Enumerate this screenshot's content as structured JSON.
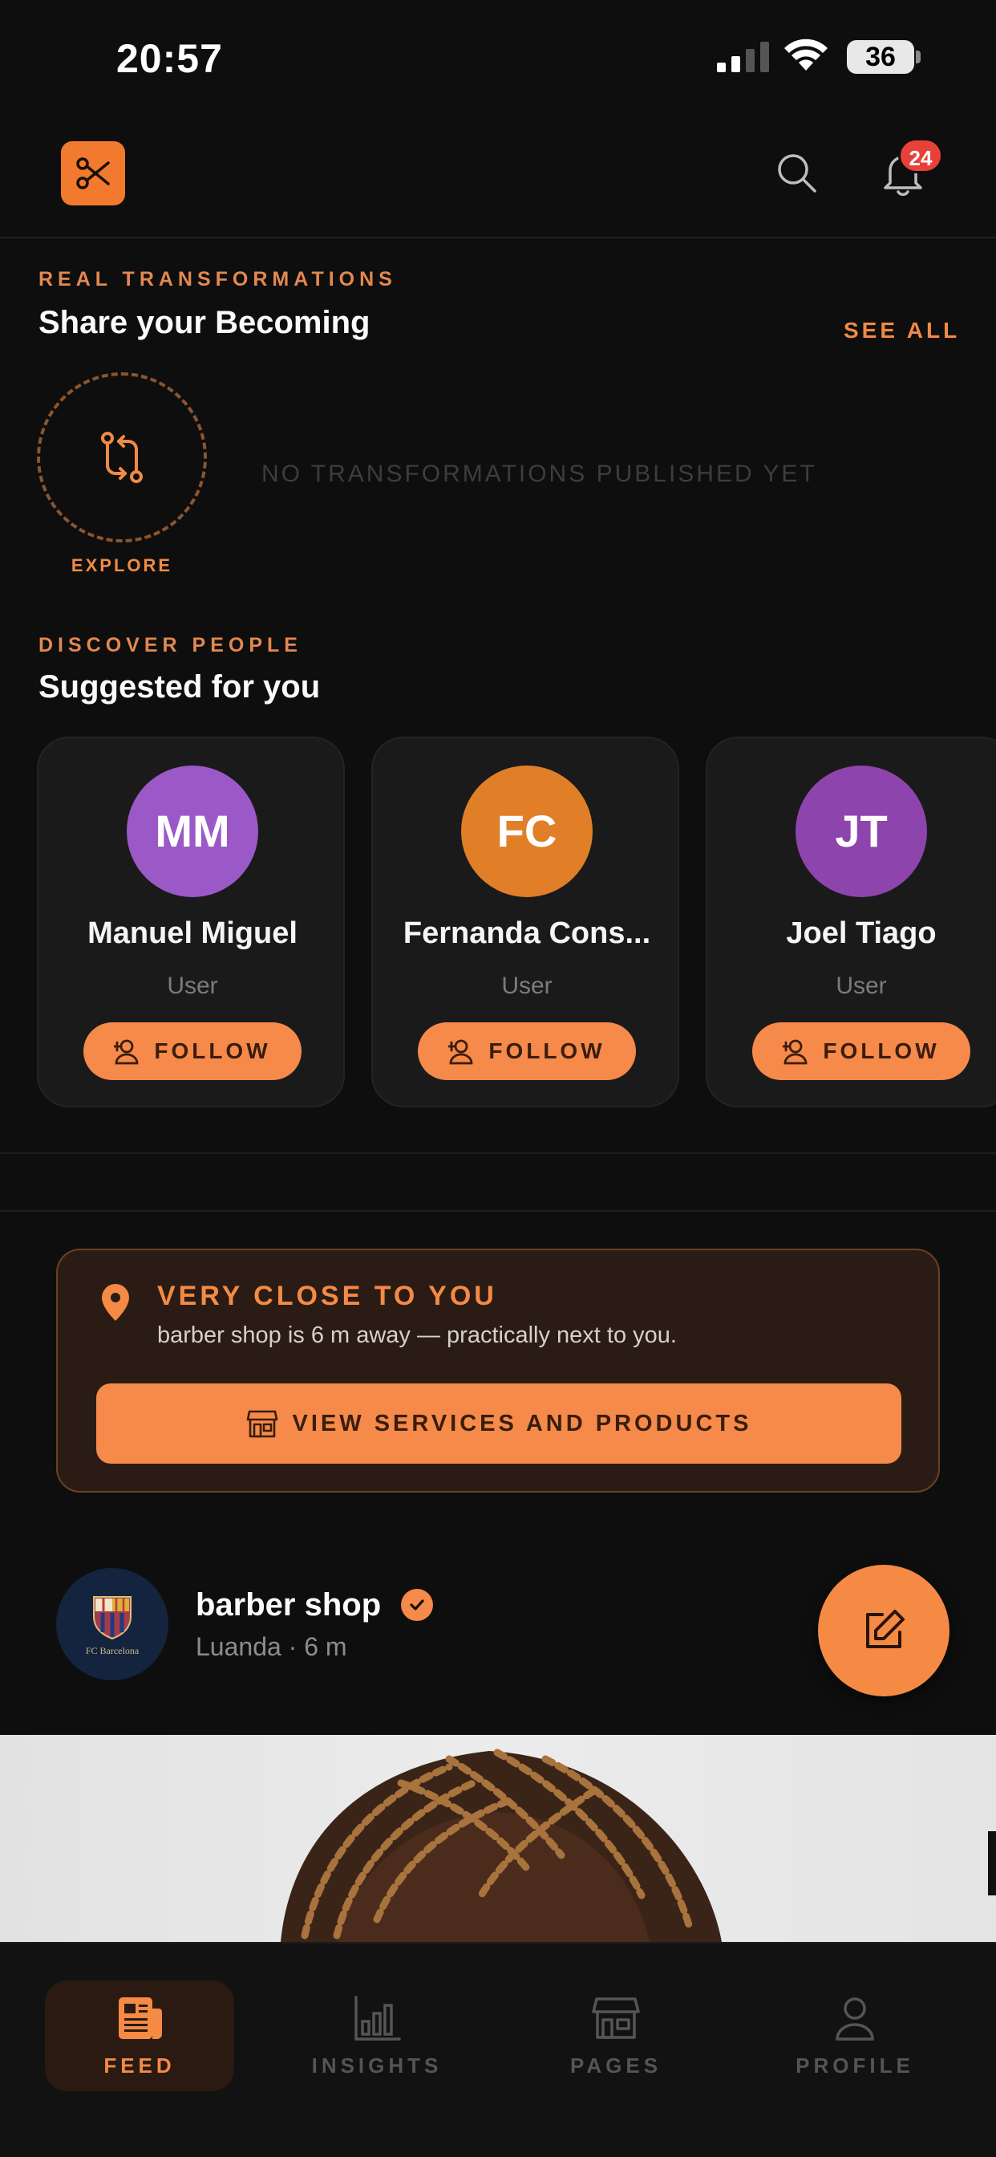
{
  "status_bar": {
    "time": "20:57",
    "battery": "36"
  },
  "header": {
    "notification_count": "24"
  },
  "transformations": {
    "eyebrow": "REAL TRANSFORMATIONS",
    "title": "Share your Becoming",
    "see_all": "SEE ALL",
    "explore_label": "EXPLORE",
    "empty_text": "NO TRANSFORMATIONS PUBLISHED YET"
  },
  "suggested": {
    "eyebrow": "DISCOVER PEOPLE",
    "title": "Suggested for you",
    "people": [
      {
        "initials": "MM",
        "name": "Manuel Miguel",
        "role": "User",
        "follow": "FOLLOW",
        "color": "#9b59c7"
      },
      {
        "initials": "FC",
        "name": "Fernanda Cons...",
        "role": "User",
        "follow": "FOLLOW",
        "color": "#e07f28"
      },
      {
        "initials": "JT",
        "name": "Joel Tiago",
        "role": "User",
        "follow": "FOLLOW",
        "color": "#8e44ad"
      }
    ]
  },
  "near_you": {
    "title": "VERY CLOSE TO YOU",
    "subtitle": "barber shop is 6 m away — practically next to you.",
    "button": "VIEW SERVICES AND PRODUCTS"
  },
  "post": {
    "author": "barber shop",
    "meta": "Luanda · 6 m",
    "avatar_text": "FC Barcelona"
  },
  "bottom_nav": [
    {
      "label": "FEED",
      "icon": "newspaper-icon",
      "active": true
    },
    {
      "label": "INSIGHTS",
      "icon": "bar-chart-icon",
      "active": false
    },
    {
      "label": "PAGES",
      "icon": "storefront-icon",
      "active": false
    },
    {
      "label": "PROFILE",
      "icon": "person-icon",
      "active": false
    }
  ],
  "colors": {
    "accent": "#f58a45",
    "background": "#0e0e0e",
    "card": "#1a1a1a",
    "badge": "#e8413a"
  }
}
